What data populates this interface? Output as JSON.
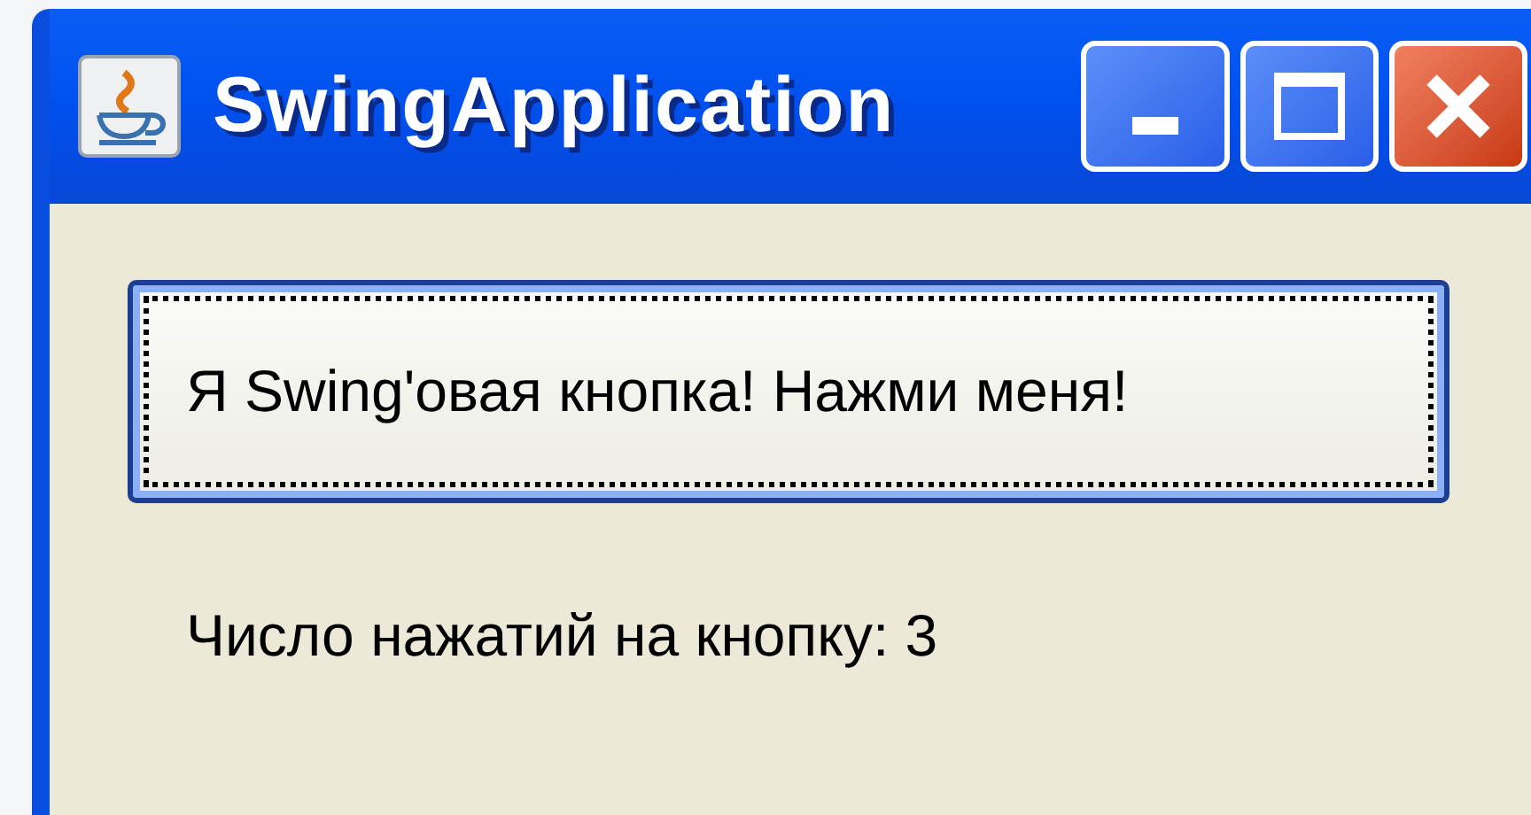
{
  "window": {
    "title": "SwingApplication"
  },
  "button": {
    "label": "Я Swing'овая кнопка! Нажми меня!",
    "focused": true
  },
  "label": {
    "text": "Число нажатий на кнопку: 3"
  }
}
